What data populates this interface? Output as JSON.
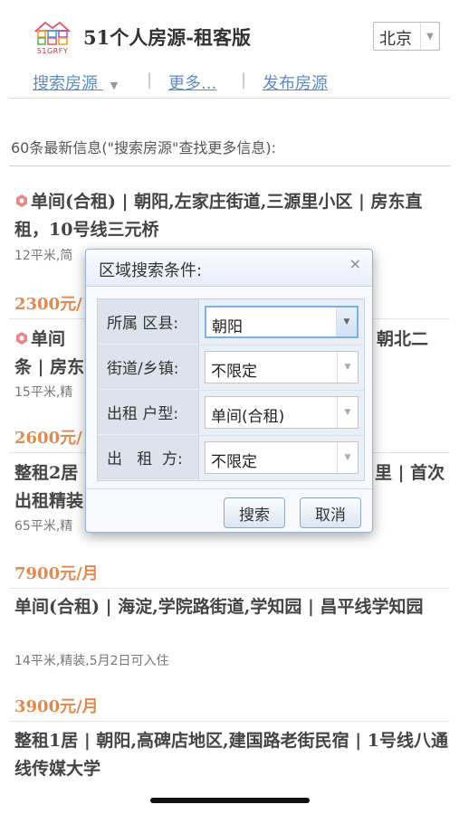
{
  "header": {
    "logo_text": "51GRFY",
    "title": "51个人房源-租客版",
    "city": "北京"
  },
  "nav": {
    "items": [
      "搜索房源",
      "更多...",
      "发布房源"
    ],
    "separator": "|"
  },
  "summary": "60条最新信息(\"搜索房源\"查找更多信息):",
  "listings": [
    {
      "title": "单间(合租) | 朝阳,左家庄街道,三源里小区 | 房东直租，10号线三元桥",
      "meta": "12平米,简",
      "price": "2300元/",
      "badge": true
    },
    {
      "title_l1": "单间",
      "title_l1_right": "朝北二",
      "title_l2": "条 | 房东",
      "meta": "15平米,精",
      "price": "2600元/",
      "badge": true
    },
    {
      "title_l1_left": "整租2居",
      "title_l1_right": "里 | 首次",
      "title_l2": "出租精装",
      "meta": "65平米,精",
      "price": "7900元/月"
    },
    {
      "title": "单间(合租) | 海淀,学院路街道,学知园 | 昌平线学知园",
      "meta": "14平米,精装,5月2日可入住",
      "price": "3900元/月"
    },
    {
      "title": "整租1居 | 朝阳,高碑店地区,建国路老街民宿 | 1号线八通线传媒大学"
    }
  ],
  "dialog": {
    "title": "区域搜索条件:",
    "close": "×",
    "rows": [
      {
        "label": "所属 区县:",
        "value": "朝阳"
      },
      {
        "label": "街道/乡镇:",
        "value": "不限定"
      },
      {
        "label": "出租 户型:",
        "value": "单间(合租)"
      },
      {
        "label": "出   租  方:",
        "value": "不限定"
      }
    ],
    "search_label": "搜索",
    "cancel_label": "取消"
  },
  "colors": {
    "accent": "#5b8cc8",
    "price": "#e08a50",
    "dialog_border": "#9ab3d3"
  }
}
